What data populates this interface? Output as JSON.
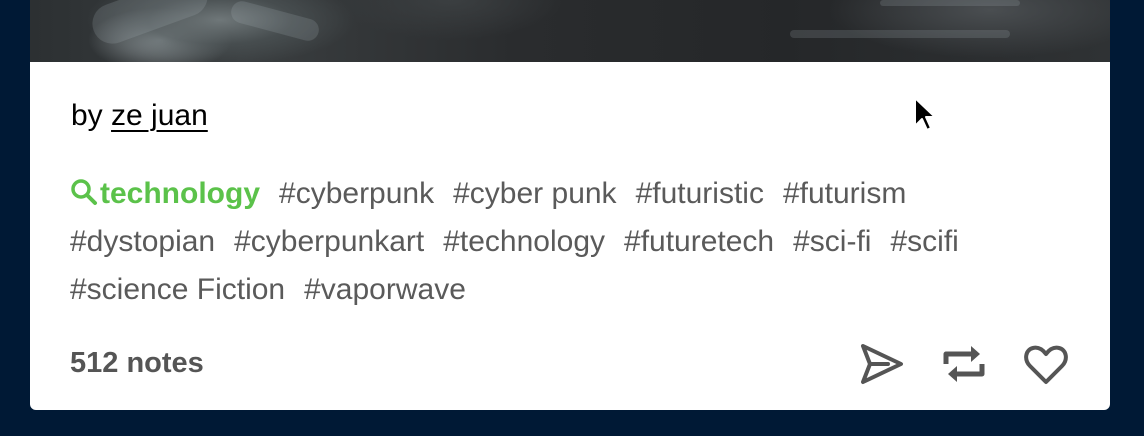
{
  "post": {
    "byline_prefix": "by",
    "author": "ze juan",
    "featured_tag": "technology",
    "tags": [
      "#cyberpunk",
      "#cyber punk",
      "#futuristic",
      "#futurism",
      "#dystopian",
      "#cyberpunkart",
      "#technology",
      "#futuretech",
      "#sci-fi",
      "#scifi",
      "#science Fiction",
      "#vaporwave"
    ],
    "notes": "512 notes"
  },
  "actions": {
    "icons": [
      "send-icon",
      "reblog-icon",
      "heart-icon"
    ]
  },
  "colors": {
    "background": "#001935",
    "card": "#ffffff",
    "featured_tag": "#5bc24a",
    "tag_text": "#555555"
  }
}
